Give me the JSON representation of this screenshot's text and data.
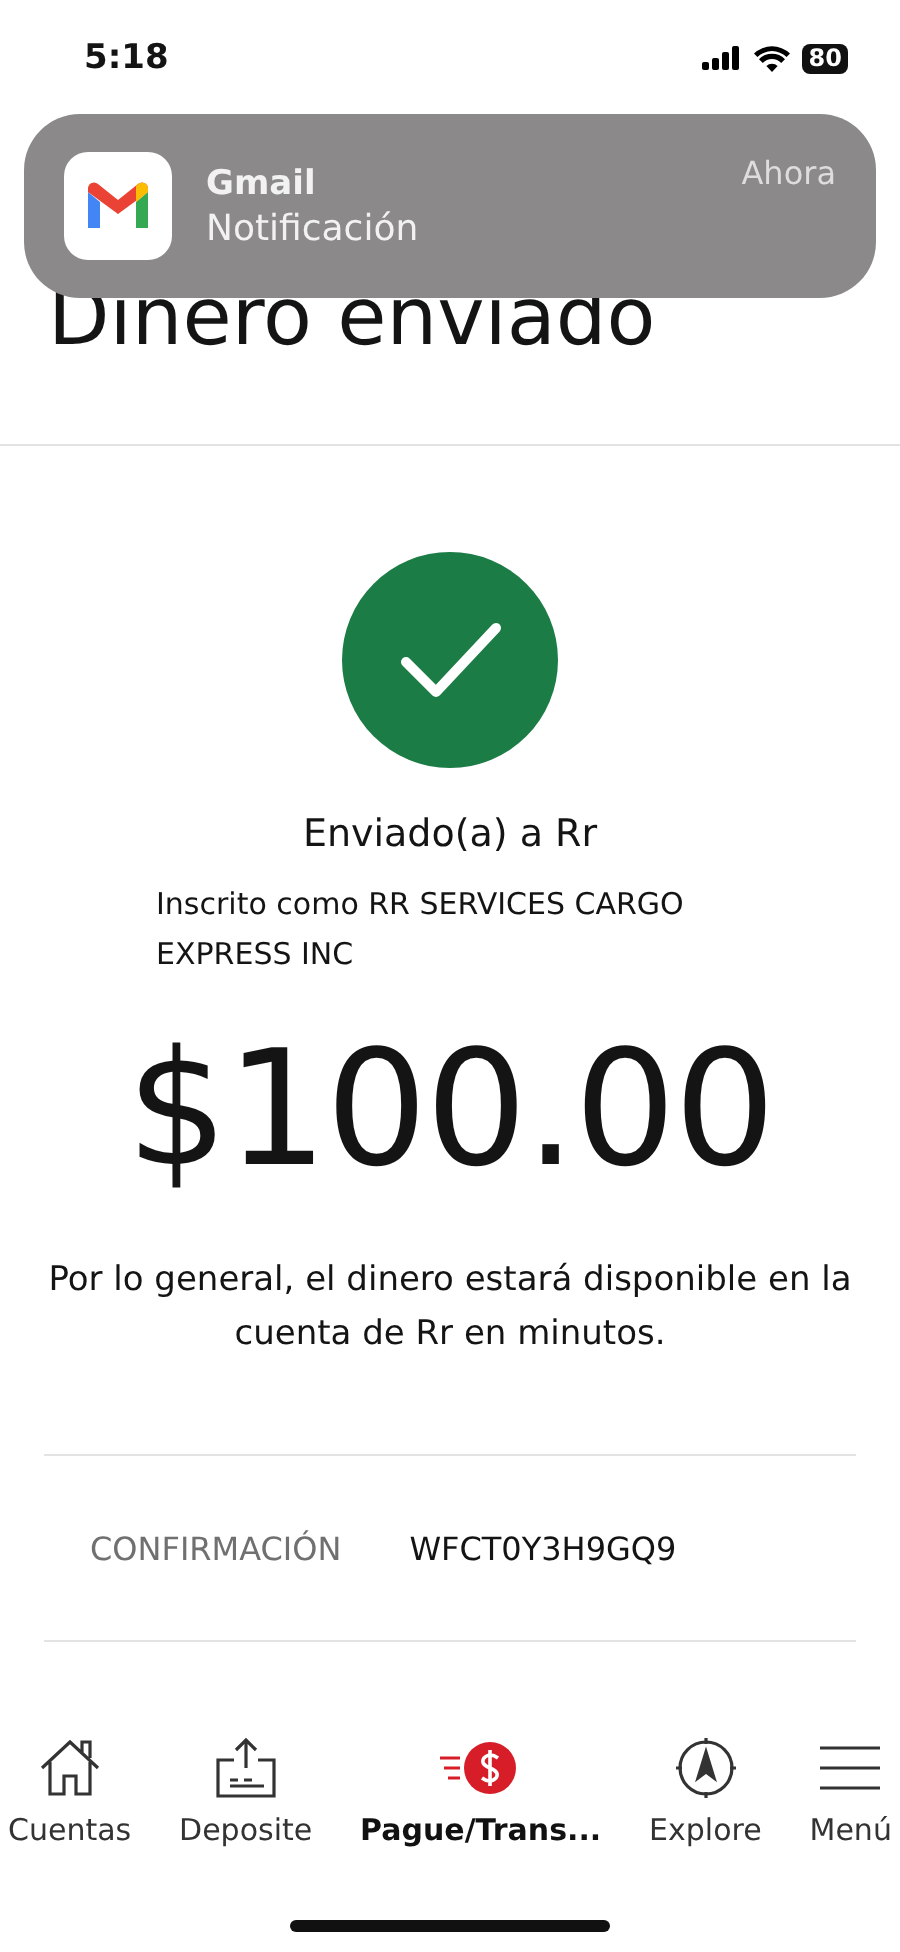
{
  "status_bar": {
    "time": "5:18",
    "battery": "80"
  },
  "notification": {
    "app": "Gmail",
    "message": "Notificación",
    "time": "Ahora"
  },
  "title": "Dinero enviado",
  "sent_to": "Enviado(a) a Rr",
  "registered_as": "Inscrito como RR SERVICES CARGO EXPRESS INC",
  "amount": "$100.00",
  "note": "Por lo general, el dinero estará disponible en la cuenta de Rr en minutos.",
  "confirmation": {
    "label": "CONFIRMACIÓN",
    "value": "WFCT0Y3H9GQ9"
  },
  "tabs": [
    {
      "label": "Cuentas",
      "kind": "home",
      "selected": false
    },
    {
      "label": "Deposite",
      "kind": "deposit",
      "selected": false
    },
    {
      "label": "Pague/Trans...",
      "kind": "pay",
      "selected": true
    },
    {
      "label": "Explore",
      "kind": "explore",
      "selected": false
    },
    {
      "label": "Menú",
      "kind": "menu",
      "selected": false
    }
  ]
}
